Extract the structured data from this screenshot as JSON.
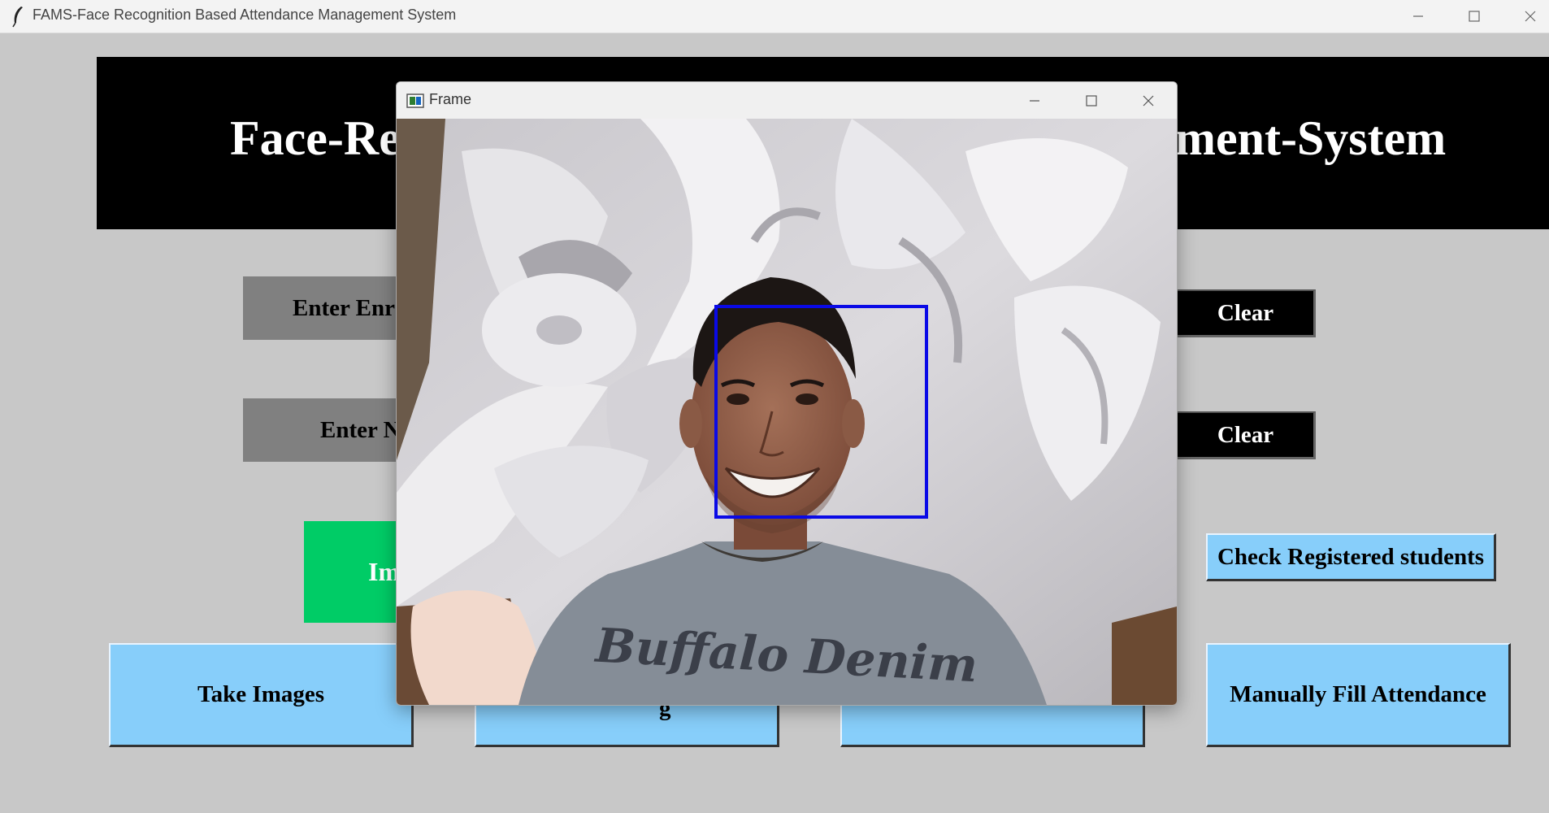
{
  "window": {
    "title": "FAMS-Face Recognition Based Attendance Management System",
    "controls": [
      "minimize",
      "maximize",
      "close"
    ]
  },
  "banner": {
    "title_left": "Face-Re",
    "title_right": "ment-System",
    "title_color": "#ffffff",
    "background": "#000000"
  },
  "form": {
    "enrollment_label": "Enter Enr",
    "name_label": "Enter N",
    "clear1_label": "Clear",
    "clear2_label": "Clear"
  },
  "buttons": {
    "images_partial_label": "Im",
    "check_registered_label": "Check Registered students",
    "take_images_label": "Take Images",
    "manually_fill_label": "Manually Fill Attendance",
    "train_partial_label": "g"
  },
  "frame_window": {
    "title": "Frame",
    "shirt_text": "Buffalo Denim",
    "face_box_color": "#0000ee"
  },
  "colors": {
    "background": "#c8c8c8",
    "label_gray": "#808080",
    "button_blue": "#87cefa",
    "button_green": "#00cc66",
    "button_black": "#000000"
  }
}
